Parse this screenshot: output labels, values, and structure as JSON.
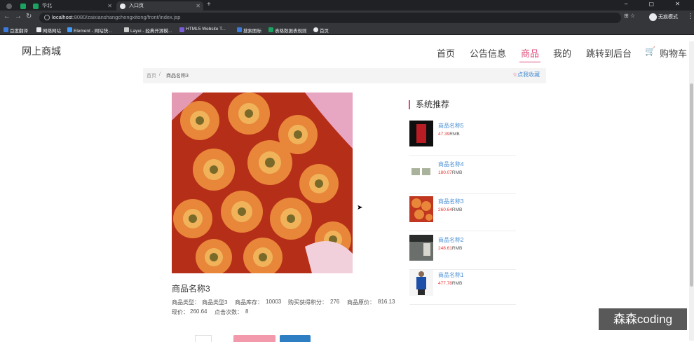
{
  "browser": {
    "tabs": [
      {
        "title": "新标签页",
        "active": false
      },
      {
        "title": "华北",
        "active": false
      },
      {
        "title": "入口页",
        "active": true
      }
    ],
    "url_host": "localhost",
    "url_path": ":8080/zaixianshangchengxitong/front/index.jsp",
    "profile_label": "无痕模式",
    "bookmarks": [
      "百度翻译",
      "网络网站",
      "Element - 网站快...",
      "Layui - 经典开源模...",
      "HTML5 Website T...",
      "搜索图标",
      "表格数据表规则",
      "首页"
    ]
  },
  "header": {
    "brand": "网上商城",
    "nav": [
      "首页",
      "公告信息",
      "商品",
      "我的",
      "跳转到后台",
      "购物车"
    ],
    "active_nav": "商品"
  },
  "breadcrumb": {
    "home": "首页",
    "separator": "/",
    "current": "商品名称3",
    "favorite": "点我收藏"
  },
  "product": {
    "name": "商品名称3",
    "type_label": "商品类型：",
    "type_value": "商品类型3",
    "stock_label": "商品库存：",
    "stock_value": "10003",
    "points_label": "购买获得积分：",
    "points_value": "276",
    "orig_price_label": "商品原价：",
    "orig_price_value": "816.13",
    "price_label": "现价：",
    "price_value": "260.64",
    "clicks_label": "点击次数：",
    "clicks_value": "8"
  },
  "recommend": {
    "title": "系统推荐",
    "items": [
      {
        "name": "商品名称5",
        "price": "47.39",
        "unit": "RMB"
      },
      {
        "name": "商品名称4",
        "price": "180.07",
        "unit": "RMB"
      },
      {
        "name": "商品名称3",
        "price": "260.64",
        "unit": "RMB"
      },
      {
        "name": "商品名称2",
        "price": "248.61",
        "unit": "RMB"
      },
      {
        "name": "商品名称1",
        "price": "477.78",
        "unit": "RMB"
      }
    ]
  },
  "watermark": "森森coding"
}
